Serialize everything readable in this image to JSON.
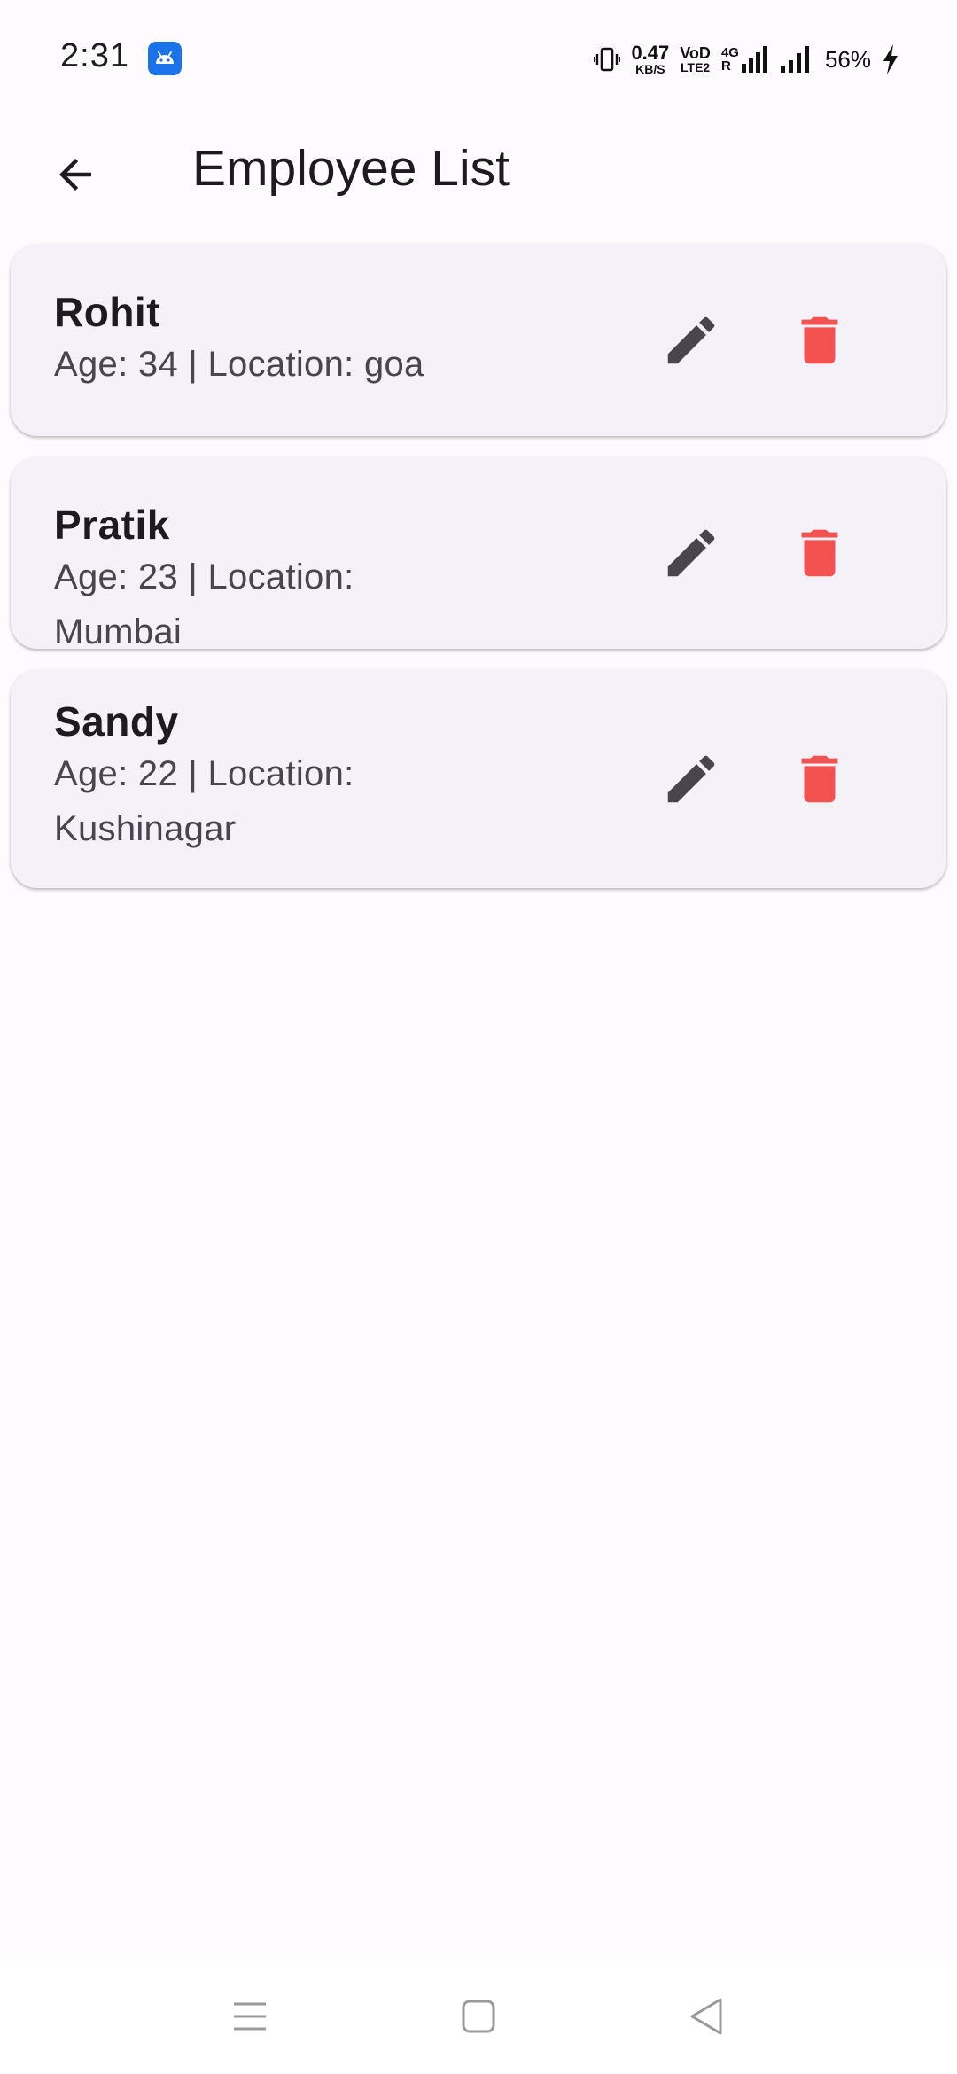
{
  "status_bar": {
    "time": "2:31",
    "net_speed_value": "0.47",
    "net_speed_unit": "KB/S",
    "volte_top": "VoD",
    "volte_bottom": "LTE2",
    "network_type": "4G",
    "network_sub": "R",
    "battery_percent": "56%"
  },
  "app_bar": {
    "title": "Employee List",
    "back_icon": "arrow-left-icon"
  },
  "employees": [
    {
      "name": "Rohit",
      "details": "Age: 34 | Location: goa"
    },
    {
      "name": "Pratik",
      "details": "Age: 23 | Location: Mumbai"
    },
    {
      "name": "Sandy",
      "details": "Age: 22 | Location: Kushinagar"
    }
  ],
  "icons": {
    "edit": "pencil-icon",
    "delete": "trash-icon"
  },
  "colors": {
    "background": "#fefbfe",
    "card": "#f4f1f8",
    "edit_icon": "#49454f",
    "delete_icon": "#f45151",
    "title_text": "#1d1b20",
    "sub_text": "#49454f"
  },
  "nav_bar": {
    "items": [
      "menu-icon",
      "home-square-icon",
      "back-triangle-icon"
    ]
  }
}
